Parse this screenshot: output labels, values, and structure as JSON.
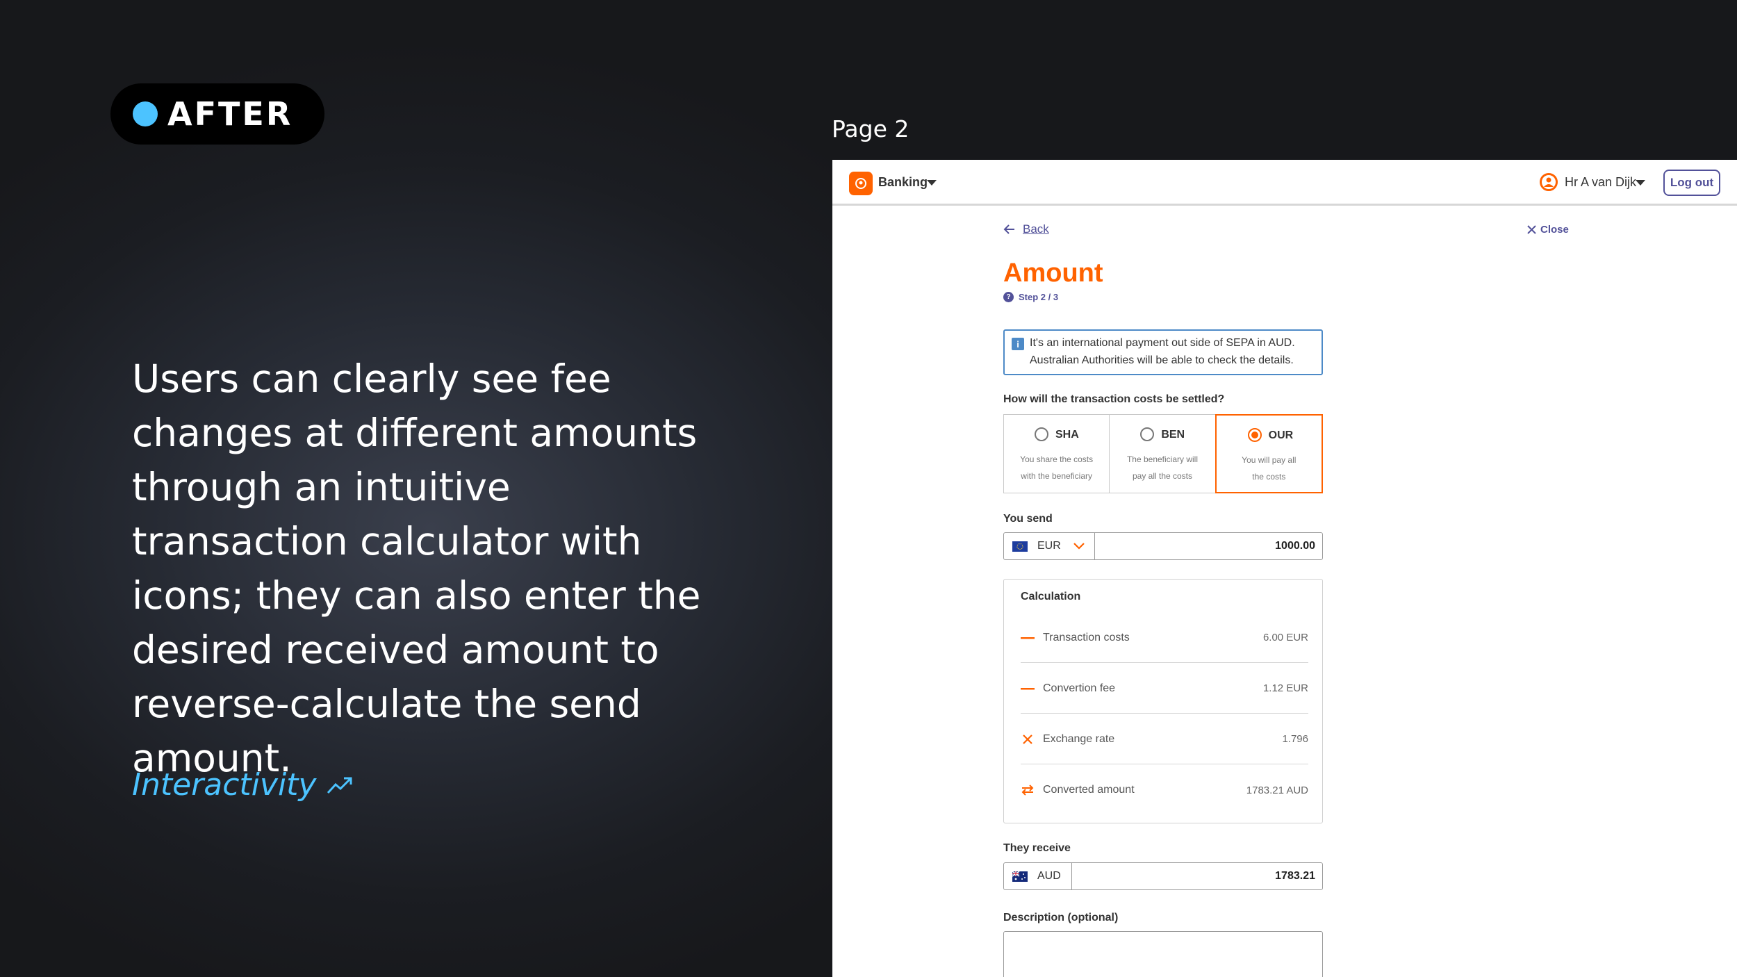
{
  "badge": {
    "label": "AFTER",
    "dot_color": "#4cc3ff"
  },
  "headline": "Users can clearly see fee changes at different amounts through an intuitive transaction calculator with icons; they can also enter the desired received amount to reverse-calculate the send amount.",
  "tag_link": {
    "label": "Interactivity",
    "icon": "trending-up-icon"
  },
  "page_label": "Page 2",
  "app": {
    "brand": "Banking",
    "user": "Hr A van Dijk",
    "logout": "Log out",
    "back": "Back",
    "close": "Close",
    "title": "Amount",
    "step": "Step 2 / 3",
    "info": {
      "line1": "It's an international payment out side of SEPA in AUD.",
      "line2": "Australian Authorities will be able to check the details."
    },
    "question": "How will the transaction costs be settled?",
    "options": [
      {
        "code": "SHA",
        "desc1": "You share the costs",
        "desc2": "with the beneficiary",
        "selected": false
      },
      {
        "code": "BEN",
        "desc1": "The beneficiary will",
        "desc2": "pay all the costs",
        "selected": false
      },
      {
        "code": "OUR",
        "desc1": "You will pay all",
        "desc2": "the costs",
        "selected": true
      }
    ],
    "send": {
      "label": "You send",
      "currency": "EUR",
      "value": "1000.00"
    },
    "calc": {
      "title": "Calculation",
      "rows": [
        {
          "label": "Transaction costs",
          "value": "6.00 EUR",
          "icon": "minus-icon"
        },
        {
          "label": "Convertion fee",
          "value": "1.12 EUR",
          "icon": "minus-icon"
        },
        {
          "label": "Exchange rate",
          "value": "1.796",
          "icon": "multiply-icon"
        },
        {
          "label": "Converted amount",
          "value": "1783.21 AUD",
          "icon": "swap-icon"
        }
      ]
    },
    "receive": {
      "label": "They receive",
      "currency": "AUD",
      "value": "1783.21"
    },
    "description_label": "Description (optional)",
    "accent_color": "#ff6200",
    "link_color": "#525199"
  }
}
